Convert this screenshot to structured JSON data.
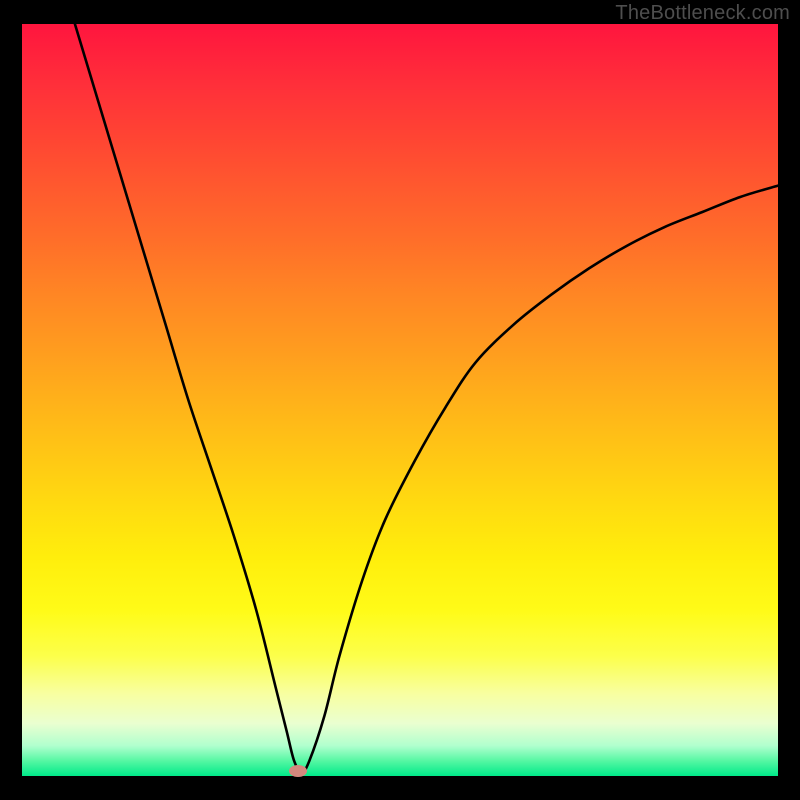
{
  "watermark": "TheBottleneck.com",
  "colors": {
    "background": "#000000",
    "marker": "#d4887e",
    "curve": "#000000"
  },
  "chart_data": {
    "type": "line",
    "title": "",
    "xlabel": "",
    "ylabel": "",
    "xlim": [
      0,
      100
    ],
    "ylim": [
      0,
      100
    ],
    "series": [
      {
        "name": "bottleneck-curve",
        "x": [
          7,
          10,
          13,
          16,
          19,
          22,
          25,
          28,
          31,
          33.5,
          35,
          36,
          37,
          38,
          40,
          42,
          45,
          48,
          52,
          56,
          60,
          65,
          70,
          75,
          80,
          85,
          90,
          95,
          100
        ],
        "y": [
          100,
          90,
          80,
          70,
          60,
          50,
          41,
          32,
          22,
          12,
          6,
          2,
          0.5,
          2,
          8,
          16,
          26,
          34,
          42,
          49,
          55,
          60,
          64,
          67.5,
          70.5,
          73,
          75,
          77,
          78.5
        ]
      }
    ],
    "marker": {
      "x": 36.5,
      "y": 0.6
    },
    "annotations": []
  }
}
